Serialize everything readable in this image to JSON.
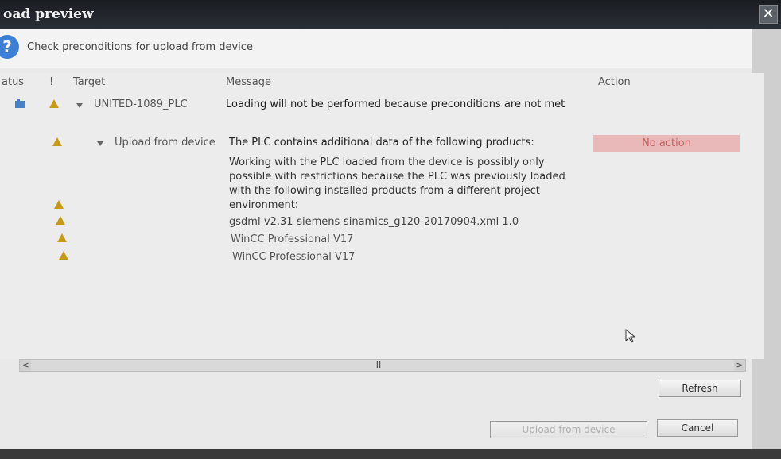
{
  "window": {
    "title": "oad preview",
    "close_symbol": "✕"
  },
  "header": {
    "icon": "question-icon",
    "subtitle": "Check preconditions for upload from device"
  },
  "table": {
    "columns": {
      "status": "atus",
      "exclaim": "!",
      "target": "Target",
      "message": "Message",
      "action": "Action"
    },
    "rows": [
      {
        "target": "UNITED-1089_PLC",
        "message": "Loading will not be performed because preconditions are not met"
      },
      {
        "target": "Upload from device",
        "message": "The PLC contains additional data of the following products:",
        "action": "No action"
      }
    ],
    "detail_lines": [
      "Working with the PLC loaded from the device is possibly only",
      "possible with restrictions because the PLC was previously loaded",
      "with the following installed products from a different project",
      "environment:"
    ],
    "products": [
      "gsdml-v2.31-siemens-sinamics_g120-20170904.xml 1.0",
      "WinCC Professional V17",
      "WinCC Professional V17"
    ]
  },
  "scrollbar": {
    "left": "<",
    "right": ">",
    "grip": "II"
  },
  "buttons": {
    "refresh": "Refresh",
    "upload": "Upload from device",
    "cancel": "Cancel"
  }
}
